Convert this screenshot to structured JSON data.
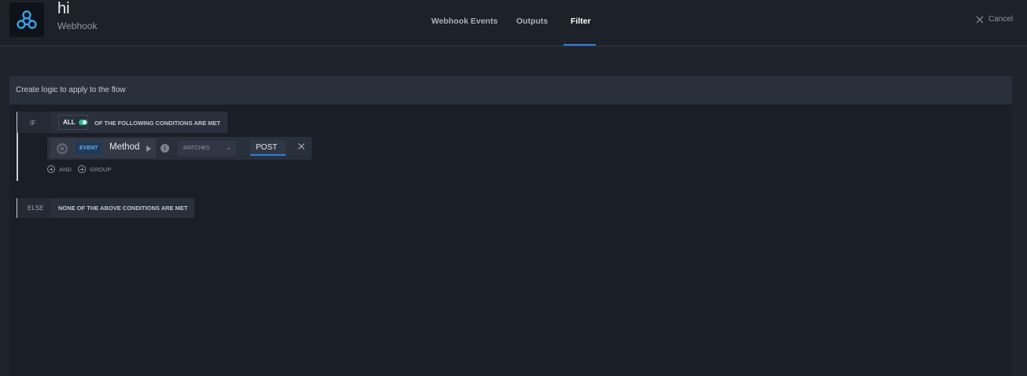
{
  "header": {
    "title": "hi",
    "subtitle": "Webhook",
    "logo_icon": "webhook-icon",
    "tabs": [
      {
        "label": "Webhook Events",
        "active": false
      },
      {
        "label": "Outputs",
        "active": false
      },
      {
        "label": "Filter",
        "active": true
      }
    ],
    "cancel_label": "Cancel"
  },
  "panel": {
    "heading": "Create logic to apply to the flow",
    "if_block": {
      "keyword": "IF",
      "quantifier": "ALL",
      "condition_text": "OF THE FOLLOWING CONDITIONS ARE MET",
      "rule": {
        "source_badge": "EVENT",
        "field": "Method",
        "operator": "MATCHES",
        "value": "POST"
      },
      "add_and_label": "AND",
      "add_group_label": "GROUP"
    },
    "else_block": {
      "keyword": "ELSE",
      "condition_text": "NONE OF THE ABOVE CONDITIONS ARE MET"
    }
  },
  "colors": {
    "accent": "#2f7fe0",
    "toggle_on": "#26b88f",
    "background": "#1f232c"
  }
}
